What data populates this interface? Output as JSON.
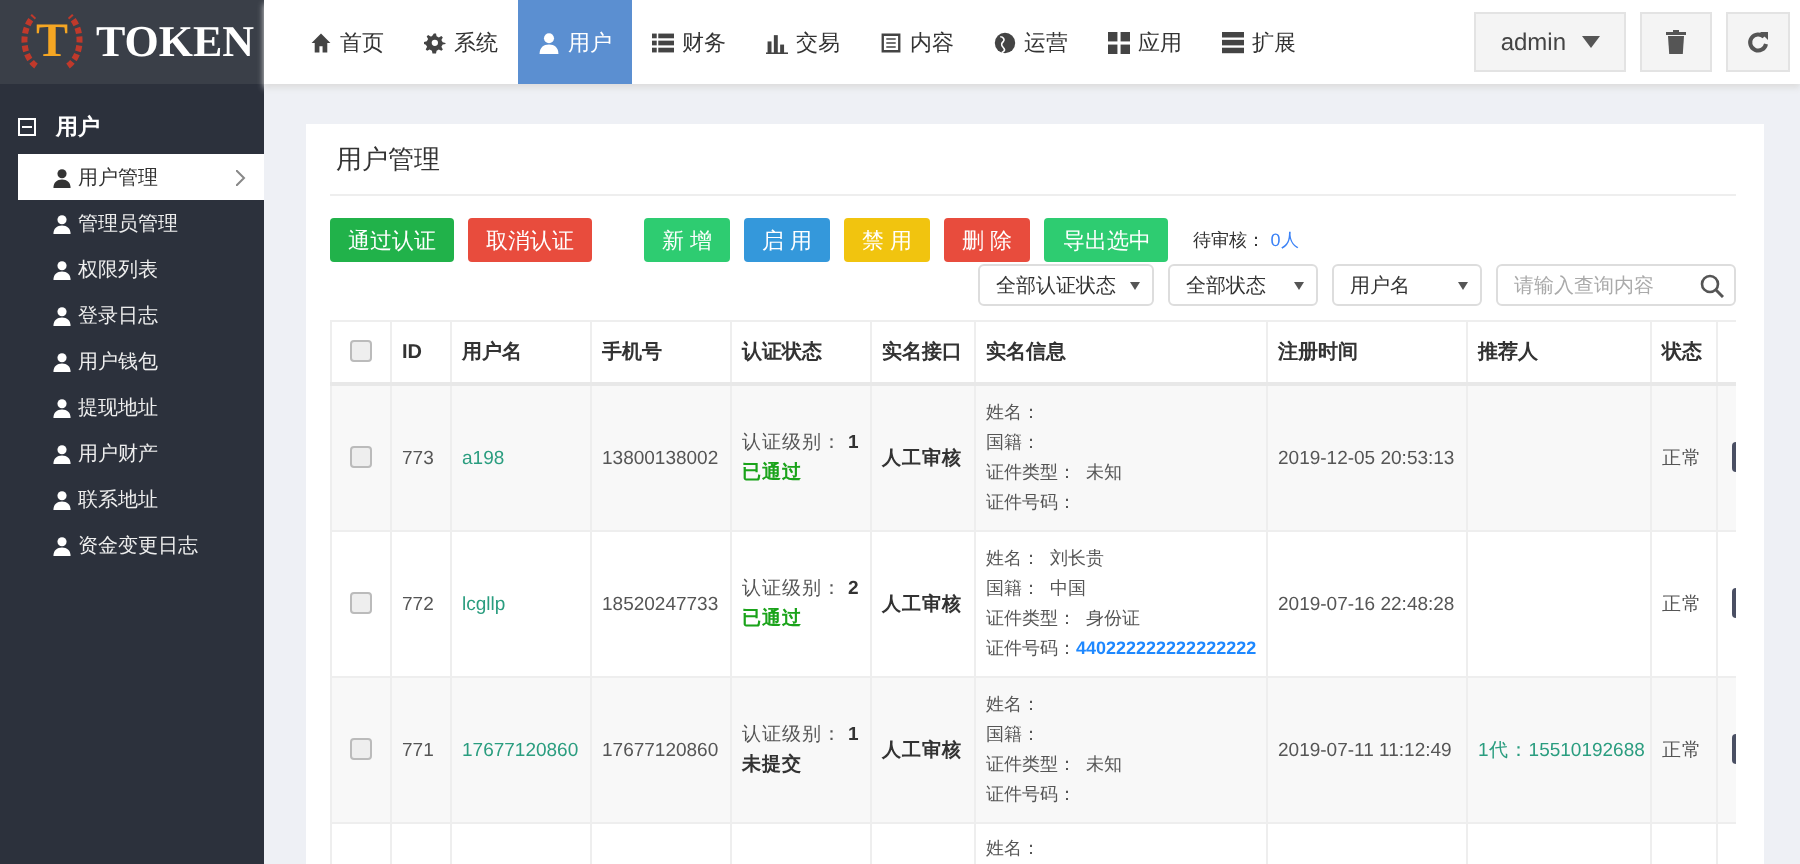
{
  "logo": {
    "letter": "T",
    "text": "TOKEN"
  },
  "nav": [
    {
      "label": "首页",
      "selected": false
    },
    {
      "label": "系统",
      "selected": false
    },
    {
      "label": "用户",
      "selected": true
    },
    {
      "label": "财务",
      "selected": false
    },
    {
      "label": "交易",
      "selected": false
    },
    {
      "label": "内容",
      "selected": false
    },
    {
      "label": "运营",
      "selected": false
    },
    {
      "label": "应用",
      "selected": false
    },
    {
      "label": "扩展",
      "selected": false
    }
  ],
  "user_menu": {
    "label": "admin"
  },
  "sidebar": {
    "section": "用户",
    "expanded": true,
    "items": [
      {
        "label": "用户管理",
        "selected": true
      },
      {
        "label": "管理员管理",
        "selected": false
      },
      {
        "label": "权限列表",
        "selected": false
      },
      {
        "label": "登录日志",
        "selected": false
      },
      {
        "label": "用户钱包",
        "selected": false
      },
      {
        "label": "提现地址",
        "selected": false
      },
      {
        "label": "用户财产",
        "selected": false
      },
      {
        "label": "联系地址",
        "selected": false
      },
      {
        "label": "资金变更日志",
        "selected": false
      }
    ]
  },
  "page": {
    "title": "用户管理"
  },
  "toolbar": {
    "buttons": [
      {
        "label": "通过认证",
        "color": "#21b24a"
      },
      {
        "label": "取消认证",
        "color": "#e84c3d"
      },
      {
        "label": "新 增",
        "color": "#2ecc71"
      },
      {
        "label": "启 用",
        "color": "#3498db"
      },
      {
        "label": "禁 用",
        "color": "#f1c40f"
      },
      {
        "label": "删 除",
        "color": "#e84c3d"
      },
      {
        "label": "导出选中",
        "color": "#2ecc71"
      }
    ],
    "pending_label": "待审核：",
    "pending_count": "0人"
  },
  "filters": {
    "selects": [
      "全部认证状态",
      "全部状态",
      "用户名"
    ],
    "search": {
      "placeholder": "请输入查询内容"
    }
  },
  "table": {
    "select_all": {
      "checked": false
    },
    "columns": [
      "ID",
      "用户名",
      "手机号",
      "认证状态",
      "实名接口",
      "实名信息",
      "注册时间",
      "推荐人",
      "状态"
    ],
    "rows": [
      {
        "checked": false,
        "id": "773",
        "username": "a198",
        "phone": "13800138002",
        "level_label": "认证级别：",
        "level_value": "1",
        "auth": "已通过",
        "auth_passed": true,
        "interface": "人工审核",
        "info": [
          {
            "label": "姓名："
          },
          {
            "label": "国籍："
          },
          {
            "label": "证件类型：",
            "value": "未知",
            "emphasis": false
          },
          {
            "label": "证件号码："
          }
        ],
        "registered": "2019-12-05 20:53:13",
        "status": "正常"
      },
      {
        "checked": false,
        "id": "772",
        "username": "lcgllp",
        "phone": "18520247733",
        "level_label": "认证级别：",
        "level_value": "2",
        "auth": "已通过",
        "auth_passed": true,
        "interface": "人工审核",
        "info": [
          {
            "label": "姓名：",
            "value": "刘长贵",
            "emphasis": false
          },
          {
            "label": "国籍：",
            "value": "中国",
            "emphasis": false
          },
          {
            "label": "证件类型：",
            "value": "身份证",
            "emphasis": false
          },
          {
            "label": "证件号码：",
            "value": "440222222222222222",
            "emphasis": true
          }
        ],
        "registered": "2019-07-16 22:48:28",
        "status": "正常"
      },
      {
        "checked": false,
        "id": "771",
        "username": "17677120860",
        "phone": "17677120860",
        "level_label": "认证级别：",
        "level_value": "1",
        "auth": "未提交",
        "auth_passed": false,
        "interface": "人工审核",
        "info": [
          {
            "label": "姓名："
          },
          {
            "label": "国籍："
          },
          {
            "label": "证件类型：",
            "value": "未知",
            "emphasis": false
          },
          {
            "label": "证件号码："
          }
        ],
        "registered": "2019-07-11 11:12:49",
        "referrer": "1代：15510192688",
        "status": "正常"
      },
      {
        "info": [
          {
            "label": "姓名："
          }
        ]
      }
    ]
  }
}
